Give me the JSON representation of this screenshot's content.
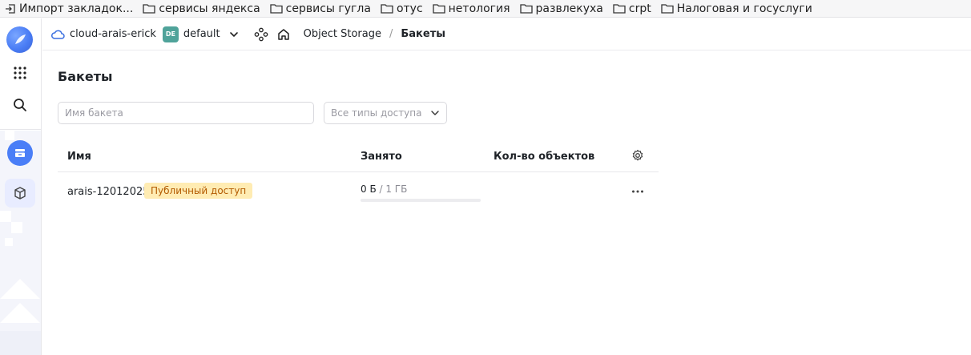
{
  "bookmarks": [
    {
      "label": "Импорт закладок...",
      "icon": "import-icon"
    },
    {
      "label": "сервисы яндекса",
      "icon": "folder-icon"
    },
    {
      "label": "сервисы гугла",
      "icon": "folder-icon"
    },
    {
      "label": "отус",
      "icon": "folder-icon"
    },
    {
      "label": "нетология",
      "icon": "folder-icon"
    },
    {
      "label": "развлекуха",
      "icon": "folder-icon"
    },
    {
      "label": "crpt",
      "icon": "folder-icon"
    },
    {
      "label": "Налоговая  и госуслуги",
      "icon": "folder-icon"
    }
  ],
  "header": {
    "cloud_name": "cloud-arais-erick",
    "folder_badge": "DE",
    "folder_name": "default",
    "breadcrumb_service": "Object Storage",
    "breadcrumb_sep": "/",
    "breadcrumb_current": "Бакеты"
  },
  "page": {
    "title": "Бакеты",
    "search_placeholder": "Имя бакета",
    "access_filter_label": "Все типы доступа"
  },
  "table": {
    "columns": [
      "Имя",
      "Занято",
      "Кол-во объектов"
    ],
    "rows": [
      {
        "name": "arais-12012025",
        "access_tag": "Публичный доступ",
        "used": "0 Б",
        "sep": " / ",
        "total": "1 ГБ",
        "usage_fraction": 0,
        "objects": ""
      }
    ]
  },
  "colors": {
    "accent": "#4a7ef7",
    "tag_bg": "#ffecb3",
    "tag_text": "#b35a00",
    "folder_badge": "#4fa39a"
  }
}
